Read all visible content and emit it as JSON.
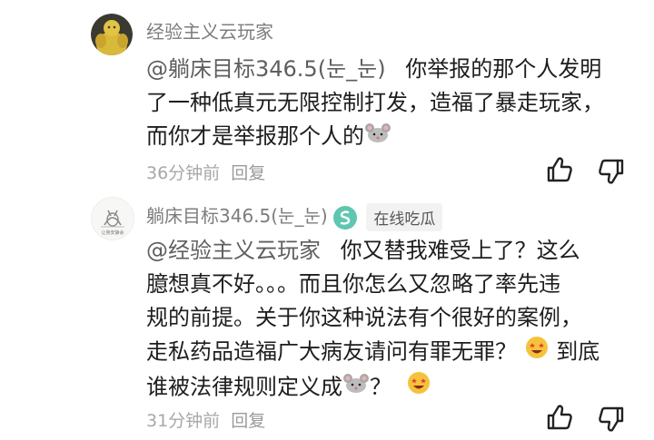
{
  "comments": [
    {
      "username": "经验主义云玩家",
      "mention": "@躺床目标346.5(눈_눈)",
      "lines": [
        "你举报的那个人发明",
        "了一种低真元无限控制打发，造福了暴走玩家，",
        "而你才是举报那个人的"
      ],
      "time": "36分钟前",
      "reply_label": "回复",
      "avatar_icon": "muscle-figure-avatar",
      "avatar_color": "#d9b93a"
    },
    {
      "username": "躺床目标346.5(눈_눈)",
      "badge_icon": "teal-s-badge-icon",
      "badge_color": "#5fc7b0",
      "tag": "在线吃瓜",
      "mention": "@经验主义云玩家",
      "lines": [
        "你又替我难受上了？这么",
        "臆想真不好。。。而且你怎么又忽略了率先违",
        "规的前提。关于你这种说法有个很好的案例，",
        "走私药品造福广大病友请问有罪无罪？",
        "到底",
        "谁被法律规则定义成",
        "？"
      ],
      "time": "31分钟前",
      "reply_label": "回复",
      "avatar_icon": "sketch-cat-avatar",
      "avatar_caption": "让我安静会"
    }
  ]
}
